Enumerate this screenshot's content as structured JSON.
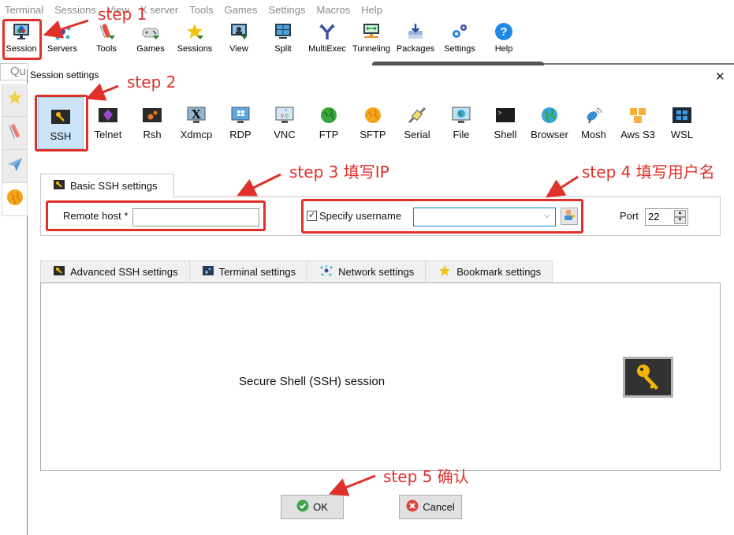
{
  "menubar": {
    "items": [
      "Terminal",
      "Sessions",
      "View",
      "X server",
      "Tools",
      "Games",
      "Settings",
      "Macros",
      "Help"
    ]
  },
  "toolbar": {
    "items": [
      {
        "label": "Session",
        "icon": "session-monitor-icon"
      },
      {
        "label": "Servers",
        "icon": "servers-network-icon"
      },
      {
        "label": "Tools",
        "icon": "tools-knife-icon"
      },
      {
        "label": "Games",
        "icon": "gamepad-icon"
      },
      {
        "label": "Sessions",
        "icon": "star-icon"
      },
      {
        "label": "View",
        "icon": "view-monitor-icon"
      },
      {
        "label": "Split",
        "icon": "split-window-icon"
      },
      {
        "label": "MultiExec",
        "icon": "multiexec-fork-icon"
      },
      {
        "label": "Tunneling",
        "icon": "tunneling-icon"
      },
      {
        "label": "Packages",
        "icon": "packages-download-icon"
      },
      {
        "label": "Settings",
        "icon": "settings-gears-icon"
      },
      {
        "label": "Help",
        "icon": "help-question-icon"
      }
    ]
  },
  "sidebar": {
    "quick_connect_placeholder": "Qu",
    "tabs": [
      {
        "icon": "star-icon"
      },
      {
        "icon": "tools-knife-icon"
      },
      {
        "icon": "paper-plane-icon"
      },
      {
        "icon": "globe-icon"
      }
    ]
  },
  "dialog": {
    "title": "Session settings",
    "close_label": "✕",
    "session_types": [
      {
        "label": "SSH",
        "selected": true
      },
      {
        "label": "Telnet"
      },
      {
        "label": "Rsh"
      },
      {
        "label": "Xdmcp"
      },
      {
        "label": "RDP"
      },
      {
        "label": "VNC"
      },
      {
        "label": "FTP"
      },
      {
        "label": "SFTP"
      },
      {
        "label": "Serial"
      },
      {
        "label": "File"
      },
      {
        "label": "Shell"
      },
      {
        "label": "Browser"
      },
      {
        "label": "Mosh"
      },
      {
        "label": "Aws S3"
      },
      {
        "label": "WSL"
      }
    ],
    "basic_tab_label": "Basic SSH settings",
    "remote_host_label": "Remote host *",
    "remote_host_value": "",
    "specify_username_label": "Specify username",
    "specify_username_checked": true,
    "username_value": "",
    "port_label": "Port",
    "port_value": "22",
    "tabs": [
      {
        "label": "Advanced SSH settings"
      },
      {
        "label": "Terminal settings"
      },
      {
        "label": "Network settings"
      },
      {
        "label": "Bookmark settings"
      }
    ],
    "description": "Secure Shell (SSH) session",
    "ok_label": "OK",
    "cancel_label": "Cancel"
  },
  "annotations": {
    "step1": "step 1",
    "step2": "step 2",
    "step3": "step 3 填写IP",
    "step4": "step 4 填写用户名",
    "step5": "step 5 确认",
    "color": "#e0302a"
  }
}
